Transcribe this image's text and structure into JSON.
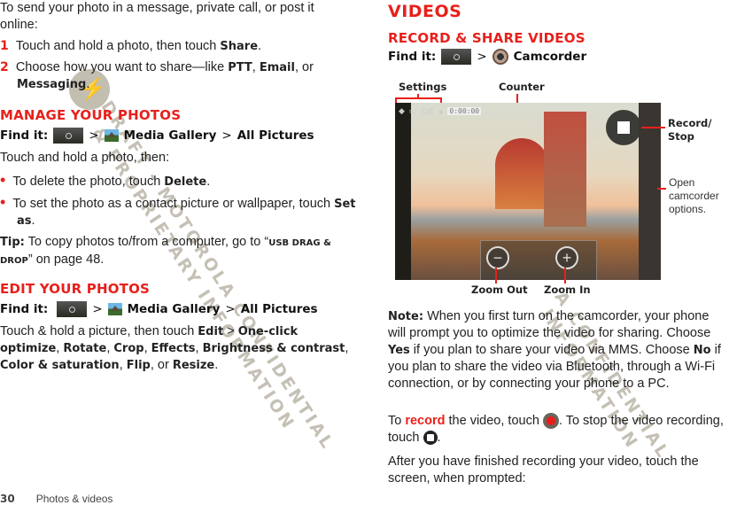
{
  "left": {
    "intro": "To send your photo in a message, private call, or post it online:",
    "steps": [
      {
        "num": "1",
        "pre": "Touch and hold a photo, then touch ",
        "bold": "Share",
        "post": "."
      },
      {
        "num": "2",
        "pre": "Choose how you want to share—like ",
        "b1": "PTT",
        "sep1": ", ",
        "b2": "Email",
        "sep2": ", or ",
        "b3": "Messaging",
        "post": "."
      }
    ],
    "manage": {
      "heading": "Manage your photos",
      "findit_label": "Find it:",
      "findit_sep1": ">",
      "findit_app": "Media Gallery",
      "findit_sep2": ">",
      "findit_target": "All Pictures",
      "intro": "Touch and hold a photo, then:",
      "bullets": [
        {
          "pre": "To delete the photo, touch ",
          "bold": "Delete",
          "post": "."
        },
        {
          "pre": "To set the photo as a contact picture or wallpaper, touch ",
          "bold": "Set as",
          "post": "."
        }
      ],
      "tip_label": "Tip:",
      "tip_pre": " To copy photos to/from a computer, go to “",
      "tip_link": "USB drag & drop",
      "tip_post": "” on page 48."
    },
    "edit": {
      "heading": "Edit your photos",
      "findit_label": "Find it:",
      "findit_sep1": ">",
      "findit_app": "Media Gallery",
      "findit_sep2": ">",
      "findit_target": "All Pictures",
      "pre": "Touch & hold a picture, then touch ",
      "items": [
        "Edit",
        "One-click optimize",
        "Rotate",
        "Crop",
        "Effects",
        "Brightness & contrast",
        "Color & saturation",
        "Flip",
        "Resize"
      ],
      "sep_gt": " > ",
      "sep_comma": ", ",
      "sep_or": ", or ",
      "post": "."
    }
  },
  "right": {
    "title": "Videos",
    "heading": "Record & share videos",
    "findit_label": "Find it:",
    "findit_sep": ">",
    "findit_app": "Camcorder",
    "figure": {
      "callouts": {
        "settings": "Settings",
        "counter": "Counter",
        "record_stop": "Record/ Stop",
        "open_options": "Open camcorder options.",
        "zoom_out": "Zoom Out",
        "zoom_in": "Zoom In"
      },
      "status_resolution": "CIF",
      "status_counter": "0:00:00"
    },
    "note_label": "Note:",
    "note_pre": " When you first turn on the camcorder, your phone will prompt you to optimize the video for sharing. Choose ",
    "note_yes": "Yes",
    "note_mid": " if you plan to share your video via MMS. Choose ",
    "note_no": "No",
    "note_post": " if you plan to share the video via Bluetooth, through a Wi-Fi connection, or by connecting your phone to a PC.",
    "record_pre": "To ",
    "record_word": "record",
    "record_mid": " the video, touch ",
    "record_mid2": ". To stop the video recording, touch ",
    "record_post": ".",
    "after": "After you have finished recording your video, touch the screen, when prompted:"
  },
  "watermark": {
    "line1": "DRAFT - MOTOROLA CONFIDENTIAL",
    "line2": "& PROPRIETARY INFORMATION",
    "line3": "A CONFIDENTIAL",
    "line4": "INFORMATION"
  },
  "footer": {
    "page_number": "30",
    "section": "Photos & videos"
  }
}
